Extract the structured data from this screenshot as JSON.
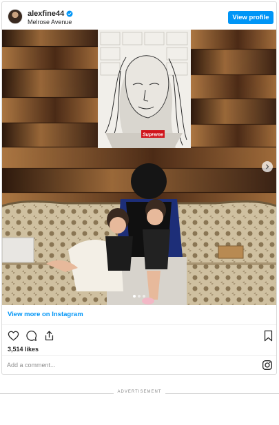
{
  "post": {
    "username": "alexfine44",
    "location": "Melrose Avenue",
    "view_profile_label": "View profile",
    "photo_sign_text": "Supreme",
    "view_more_label": "View more on Instagram",
    "likes_text": "3,514 likes",
    "comment_placeholder": "Add a comment...",
    "carousel": {
      "total": 3,
      "active_index": 0
    }
  },
  "advertisement": {
    "label": "ADVERTISEMENT"
  },
  "icons": [
    "verified-badge-icon",
    "heart-icon",
    "comment-icon",
    "share-icon",
    "bookmark-icon",
    "instagram-icon",
    "chevron-right-icon"
  ],
  "colors": {
    "accent": "#0095f6",
    "border": "#dbdbdb",
    "text": "#262626",
    "muted": "#8e8e8e"
  }
}
